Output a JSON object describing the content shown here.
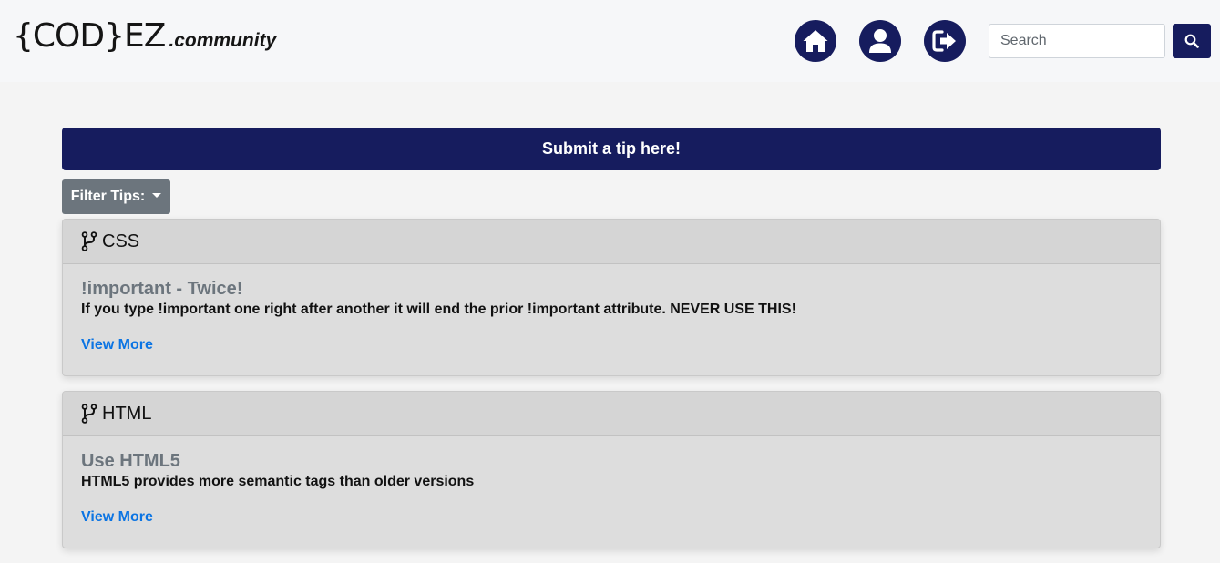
{
  "brand": {
    "logo_main": "{COD}EZ",
    "logo_sub": ".community"
  },
  "nav": {
    "icons": [
      "home-icon",
      "user-icon",
      "sign-out-icon"
    ],
    "accent_color": "#161c5e"
  },
  "search": {
    "placeholder": "Search",
    "value": "",
    "button_icon": "search-icon"
  },
  "submit": {
    "label": "Submit a tip here!"
  },
  "filter": {
    "label": "Filter Tips:"
  },
  "tips": [
    {
      "category": "CSS",
      "category_icon": "code-branch-icon",
      "title": "!important - Twice!",
      "body": "If you type !important one right after another it will end the prior !important attribute. NEVER USE THIS!",
      "link": "View More"
    },
    {
      "category": "HTML",
      "category_icon": "code-branch-icon",
      "title": "Use HTML5",
      "body": "HTML5 provides more semantic tags than older versions",
      "link": "View More"
    }
  ]
}
